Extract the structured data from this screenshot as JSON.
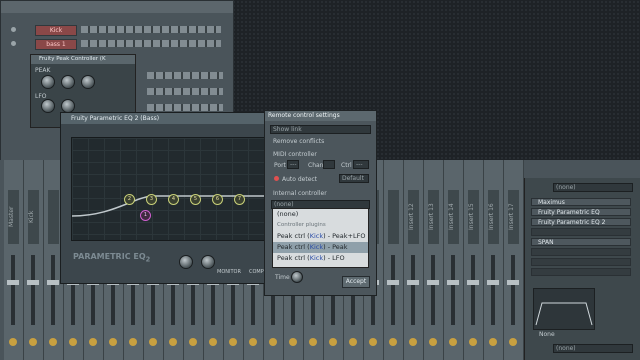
{
  "sequencer": {
    "channels": [
      {
        "name": "Kick",
        "color": "#8a4848"
      },
      {
        "name": "bass 1",
        "color": "#8a4848"
      }
    ]
  },
  "peak_controller": {
    "title": "Fruity Peak Controller (K",
    "peak_label": "PEAK",
    "lfo_label": "LFO"
  },
  "eq_window": {
    "title": "Fruity Parametric EQ 2 (Bass)",
    "logo_main": "PARAMETRIC EQ",
    "logo_sub": "2",
    "monitor_label": "MONITOR",
    "comp_label": "COMP",
    "bands": [
      "2",
      "3",
      "4",
      "5",
      "6",
      "7"
    ],
    "peak_band": "1"
  },
  "dialog": {
    "title": "Remote control settings",
    "show_link": "Show link",
    "remove_conflicts": "Remove conflicts",
    "midi_controller": "MIDI controller",
    "port_label": "Port",
    "chan_label": "Chan",
    "ctrl_label": "Ctrl",
    "port_value": "---",
    "chan_value": "",
    "ctrl_value": "---",
    "auto_detect": "Auto detect",
    "default_value": "Default",
    "internal_controller": "Internal controller",
    "internal_value": "(none)",
    "time_label": "Time",
    "accept_button": "Accept"
  },
  "dropdown": {
    "items": [
      {
        "prefix": "(none)",
        "kick": "",
        "suffix": "",
        "selected": false
      },
      {
        "prefix": "Controller plugins",
        "kick": "",
        "suffix": "",
        "selected": false,
        "header": true
      },
      {
        "prefix": "Peak ctrl (",
        "kick": "Kick",
        "suffix": ") - Peak+LFO",
        "selected": false
      },
      {
        "prefix": "Peak ctrl (",
        "kick": "Kick",
        "suffix": ") - Peak",
        "selected": true
      },
      {
        "prefix": "Peak ctrl (",
        "kick": "Kick",
        "suffix": ") - LFO",
        "selected": false
      }
    ]
  },
  "mixer": {
    "strips": [
      "Master",
      "Kick",
      "",
      "",
      "",
      "",
      "",
      "",
      "",
      "",
      "",
      "",
      "",
      "",
      "",
      "",
      "",
      "",
      "",
      "",
      "Insert 12",
      "Insert 13",
      "Insert 14",
      "Insert 15",
      "Insert 16",
      "Insert 17"
    ],
    "fx_header": "(none)",
    "fx_slots": [
      "Maximus",
      "Fruity Parametric EQ",
      "Fruity Parametric EQ 2",
      "",
      "SPAN",
      "",
      "",
      ""
    ],
    "fx_footer": "(none)",
    "none_label": "None"
  }
}
